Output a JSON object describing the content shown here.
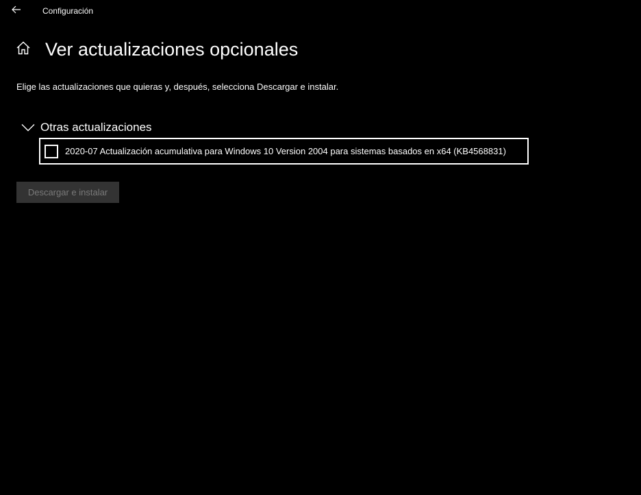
{
  "window": {
    "title": "Configuración"
  },
  "header": {
    "title": "Ver actualizaciones opcionales",
    "home_icon": "home-icon",
    "back_icon": "back-arrow-icon"
  },
  "description": "Elige las actualizaciones que quieras y, después, selecciona Descargar e instalar.",
  "section": {
    "title": "Otras actualizaciones",
    "expanded": true,
    "items": [
      {
        "label": "2020-07 Actualización acumulativa para Windows 10 Version 2004 para sistemas basados en x64 (KB4568831)",
        "checked": false
      }
    ]
  },
  "actions": {
    "install_label": "Descargar e instalar",
    "install_enabled": false
  },
  "colors": {
    "background": "#000000",
    "text": "#ffffff",
    "disabled_button_bg": "#333333",
    "disabled_button_text": "#7a7a7a"
  }
}
